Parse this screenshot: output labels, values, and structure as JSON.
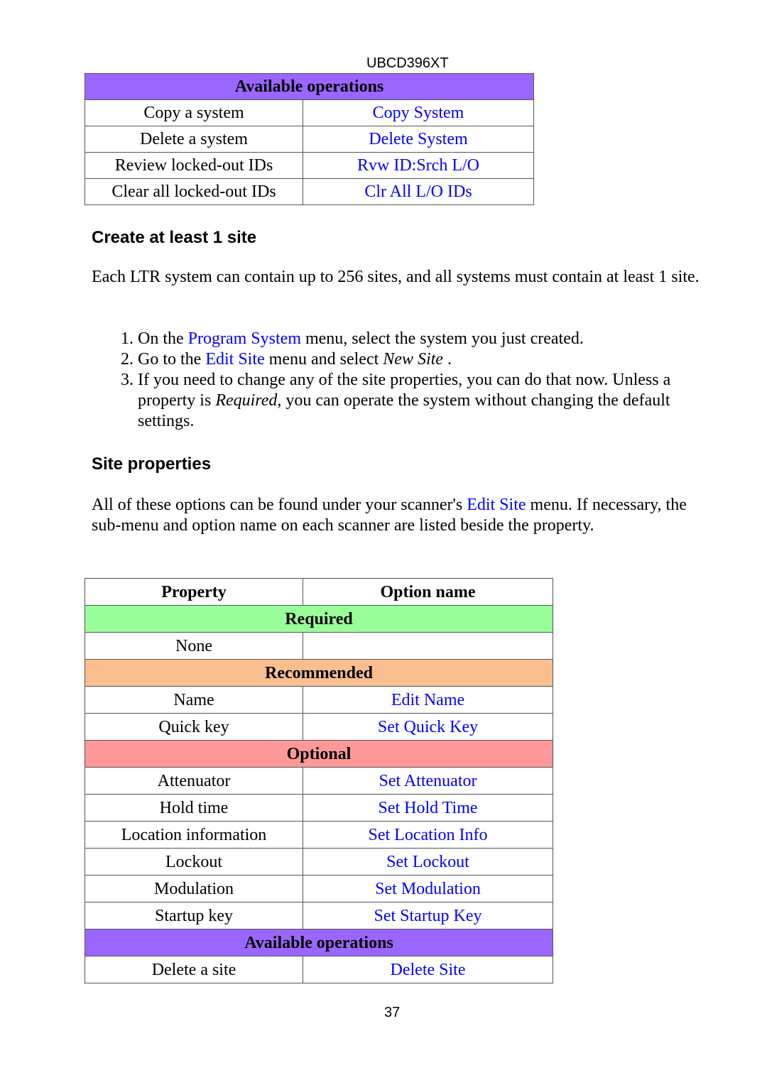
{
  "header": {
    "title": "UBCD396XT"
  },
  "operations_table": {
    "band": "Available operations",
    "rows": [
      {
        "description": "Copy a system",
        "option": "Copy System"
      },
      {
        "description": "Delete a system",
        "option": "Delete System"
      },
      {
        "description": "Review locked-out IDs",
        "option": "Rvw ID:Srch L/O"
      },
      {
        "description": "Clear all locked-out IDs",
        "option": "Clr All L/O IDs"
      }
    ]
  },
  "section_create": {
    "heading": "Create at least 1 site",
    "intro": "Each LTR system can contain up to 256 sites, and all systems must contain at least 1 site.",
    "steps": [
      {
        "before": "On the ",
        "link": "Program System",
        "after": " menu, select the system you just created."
      },
      {
        "before": "Go to the ",
        "link": "Edit Site",
        "middle": " menu and select ",
        "italic": "New Site",
        "after": " ."
      },
      {
        "before": "If you need to change any of the site properties, you can do that now. Unless a property is ",
        "italic": "Required",
        "after": ", you can operate the system without changing the default settings."
      }
    ]
  },
  "section_properties": {
    "heading": "Site properties",
    "intro_before": "All of these options can be found under your scanner's ",
    "intro_link": "Edit Site",
    "intro_after": " menu. If necessary, the sub-menu and option name on each scanner are listed beside the property."
  },
  "properties_table": {
    "headers": {
      "property": "Property",
      "option": "Option name"
    },
    "required": {
      "band": "Required",
      "rows": [
        {
          "property": "None",
          "option": ""
        }
      ]
    },
    "recommended": {
      "band": "Recommended",
      "rows": [
        {
          "property": "Name",
          "option": "Edit Name"
        },
        {
          "property": "Quick key",
          "option": "Set Quick Key"
        }
      ]
    },
    "optional": {
      "band": "Optional",
      "rows": [
        {
          "property": "Attenuator",
          "option": "Set Attenuator"
        },
        {
          "property": "Hold time",
          "option": "Set Hold Time"
        },
        {
          "property": "Location information",
          "option": "Set Location Info"
        },
        {
          "property": "Lockout",
          "option": "Set Lockout"
        },
        {
          "property": "Modulation",
          "option": "Set Modulation"
        },
        {
          "property": "Startup key",
          "option": "Set Startup Key"
        }
      ]
    },
    "operations": {
      "band": "Available operations",
      "rows": [
        {
          "property": "Delete a site",
          "option": "Delete Site"
        }
      ]
    }
  },
  "footer": {
    "page_number": "37"
  },
  "colors": {
    "link": "#0000ff",
    "band_operations": "#9966ff",
    "band_required": "#99ff99",
    "band_recommended": "#f9bf8f",
    "band_optional": "#ff9999"
  }
}
